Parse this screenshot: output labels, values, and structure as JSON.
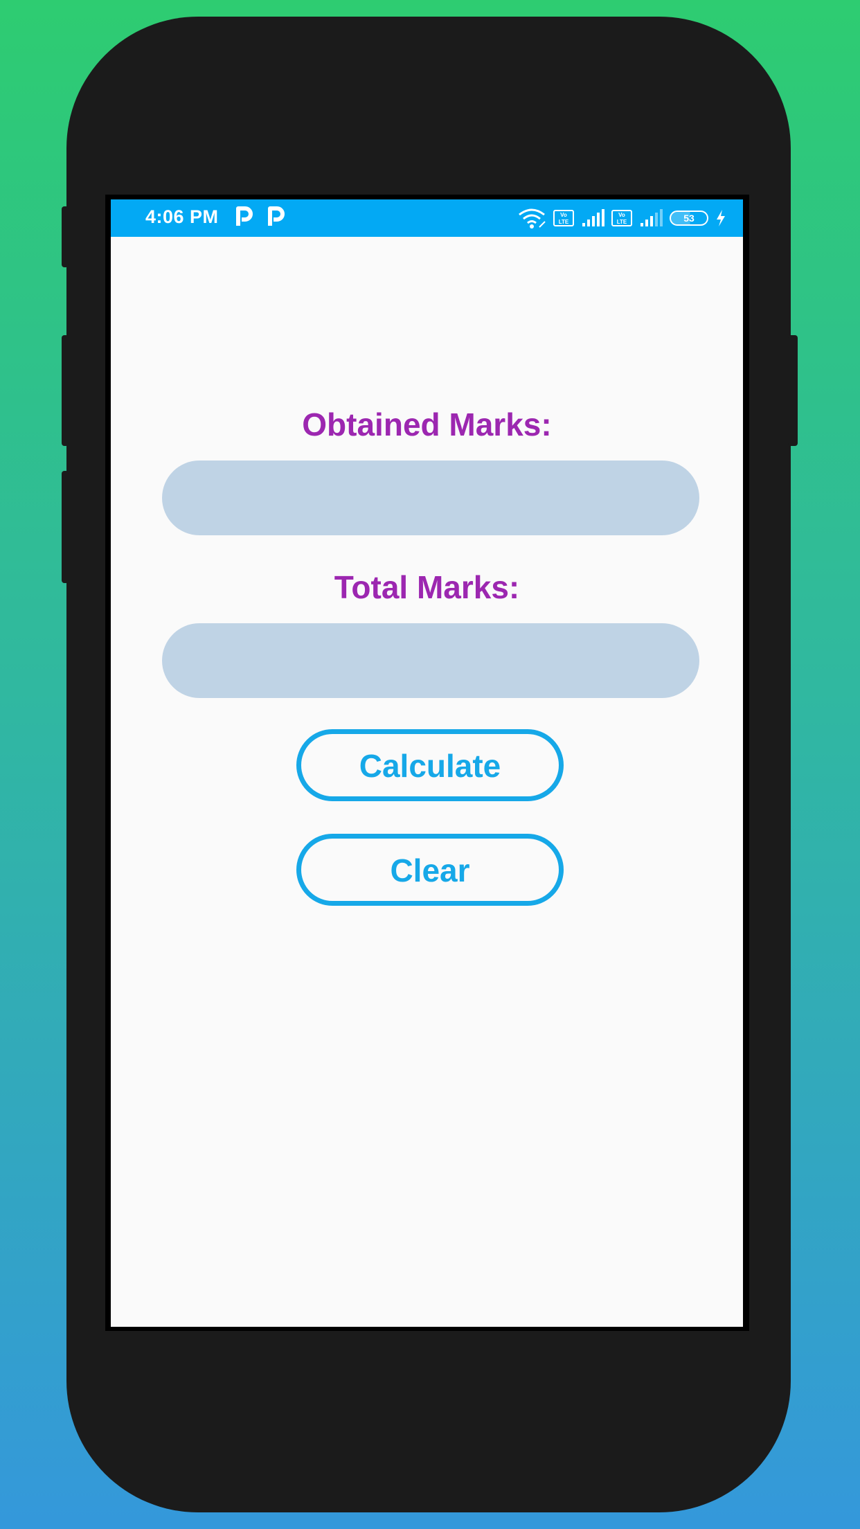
{
  "status_bar": {
    "time": "4:06 PM",
    "battery_level": "53",
    "volte_label": "Vo LTE",
    "colors": {
      "background": "#03a9f4"
    },
    "icons": [
      "parking-icon",
      "parking-icon",
      "wifi-icon",
      "volte-icon",
      "signal-icon",
      "volte-icon",
      "signal-icon",
      "battery-icon",
      "charging-icon"
    ]
  },
  "form": {
    "obtained_label": "Obtained Marks:",
    "obtained_value": "",
    "total_label": "Total Marks:",
    "total_value": "",
    "calculate_label": "Calculate",
    "clear_label": "Clear"
  },
  "colors": {
    "label": "#9c27b0",
    "input_bg": "#bfd3e5",
    "button": "#16a8e8",
    "screen_bg": "#fafafa"
  }
}
